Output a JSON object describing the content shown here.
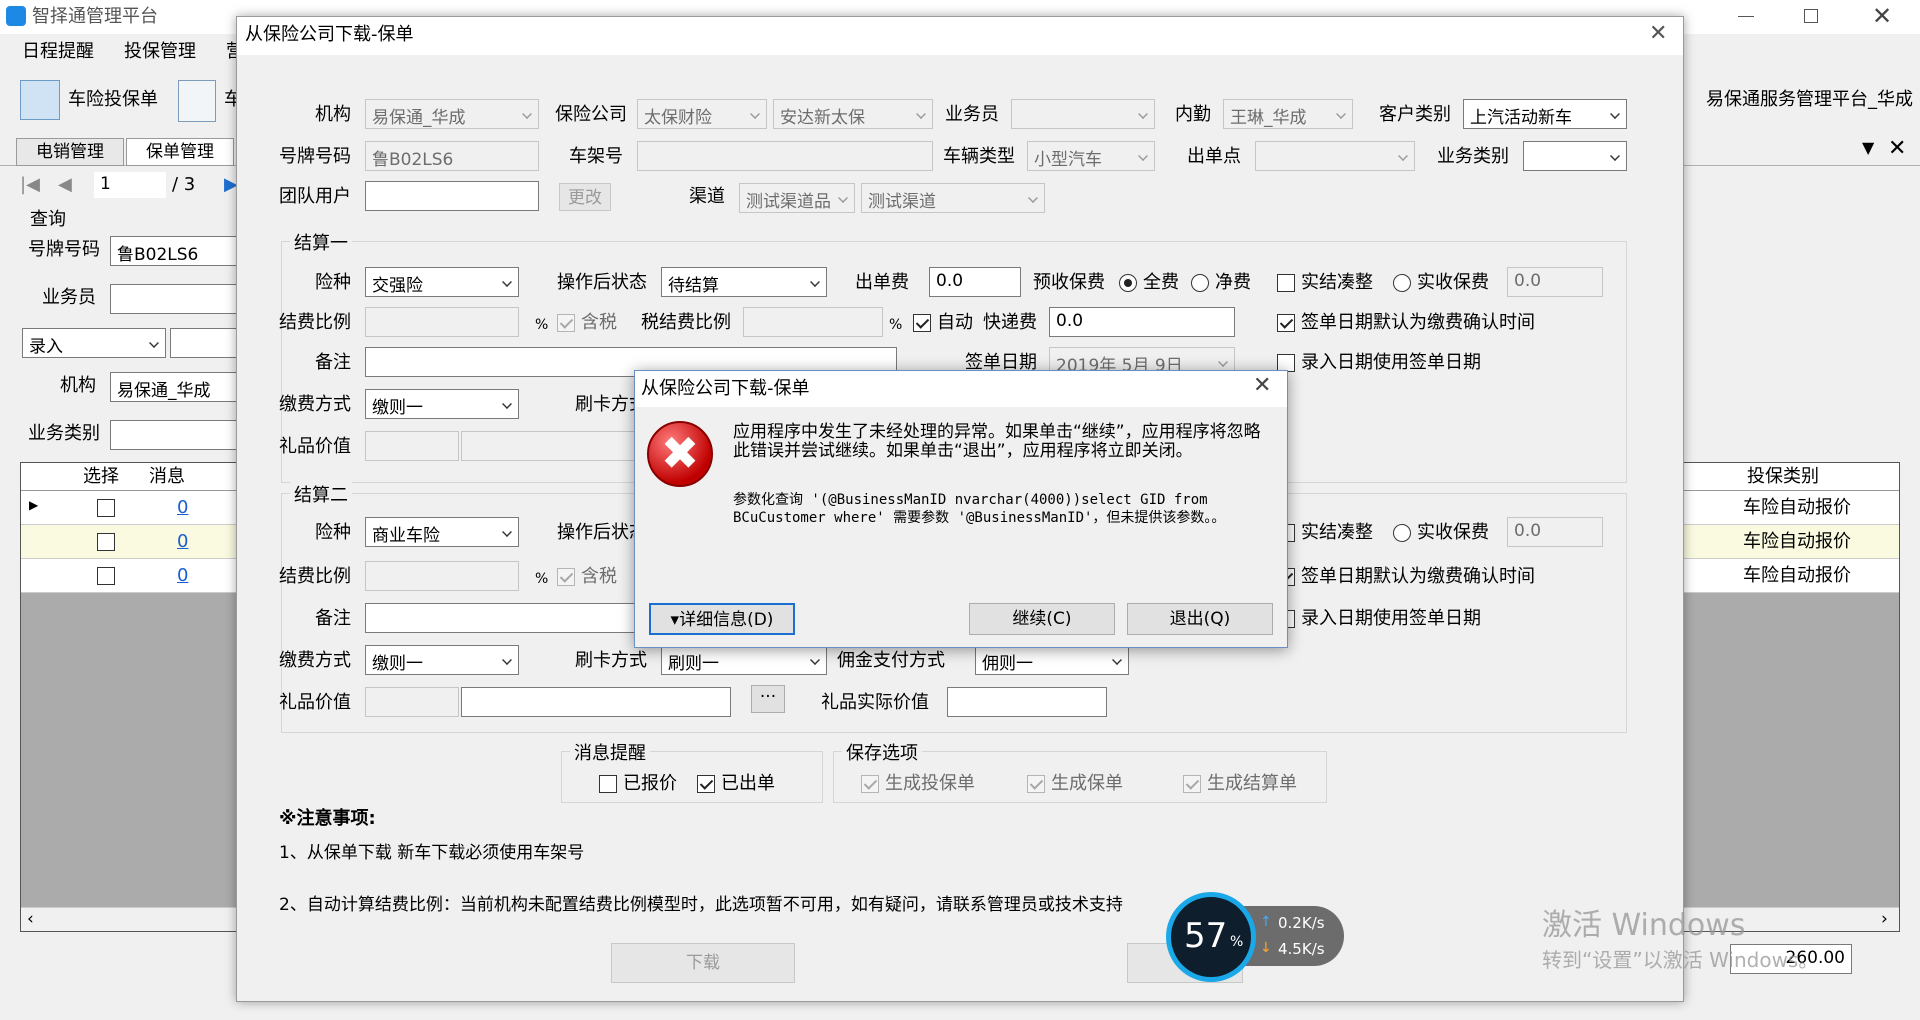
{
  "app": {
    "title": "智择通管理平台",
    "brand": "易保通服务管理平台_华成"
  },
  "menu": [
    "日程提醒",
    "投保管理",
    "营"
  ],
  "toolbar": {
    "car_ins": "车险投保单",
    "second": "车"
  },
  "tabs": [
    "电销管理",
    "保单管理"
  ],
  "pager": {
    "page": "1",
    "total": "/ 3"
  },
  "query": {
    "title": "查询",
    "plate_label": "号牌号码",
    "plate_value": "鲁B02LS6",
    "agent_label": "业务员",
    "entry_select": "录入",
    "org_label": "机构",
    "org_value": "易保通_华成",
    "biz_label": "业务类别"
  },
  "grid": {
    "col_select": "选择",
    "col_msg": "消息",
    "col_type": "投保类别",
    "rows": [
      {
        "msg": "0",
        "type": "车险自动报价"
      },
      {
        "msg": "0",
        "type": "车险自动报价"
      },
      {
        "msg": "0",
        "type": "车险自动报价"
      }
    ],
    "right_value": "260.00"
  },
  "form": {
    "title": "从保险公司下载-保单",
    "org_label": "机构",
    "org_value": "易保通_华成",
    "ins_label": "保险公司",
    "ins_value1": "太保财险",
    "ins_value2": "安达新太保",
    "agent_label": "业务员",
    "agent_value": "",
    "inner_label": "内勤",
    "inner_value": "王琳_华成",
    "cust_label": "客户类别",
    "cust_value": "上汽活动新车",
    "plate_label": "号牌号码",
    "plate_value": "鲁B02LS6",
    "vin_label": "车架号",
    "vin_value": "",
    "vtype_label": "车辆类型",
    "vtype_value": "小型汽车",
    "outlet_label": "出单点",
    "outlet_value": "",
    "biz_label": "业务类别",
    "biz_value": "",
    "team_label": "团队用户",
    "team_value": "",
    "change_btn": "更改",
    "channel_label": "渠道",
    "channel_value1": "测试渠道品",
    "channel_value2": "测试渠道",
    "s1": {
      "title": "结算一",
      "kind_label": "险种",
      "kind_value": "交强险",
      "status_label": "操作后状态",
      "status_value": "待结算",
      "fee_label": "出单费",
      "fee_value": "0.0",
      "pre_label": "预收保费",
      "full": "全费",
      "net": "净费",
      "real": "实结凑整",
      "realfee": "实收保费",
      "realfee_value": "0.0",
      "ratio_label": "结费比例",
      "pct": "%",
      "tax": "含税",
      "taxratio_label": "税结费比例",
      "auto": "自动",
      "express_label": "快递费",
      "express_value": "0.0",
      "signdef": "签单日期默认为缴费确认时间",
      "remark_label": "备注",
      "signdate_label": "签单日期",
      "signdate_value": "2019年 5月 9日",
      "entrydate": "录入日期使用签单日期",
      "pay_label": "缴费方式",
      "pay_value": "缴则一",
      "card_label": "刷卡方式",
      "gift_label": "礼品价值"
    },
    "s2": {
      "title": "结算二",
      "kind_label": "险种",
      "kind_value": "商业车险",
      "status_label": "操作后状态",
      "real": "实结凑整",
      "realfee": "实收保费",
      "realfee_value": "0.0",
      "ratio_label": "结费比例",
      "pct": "%",
      "tax": "含税",
      "signdef": "签单日期默认为缴费确认时间",
      "remark_label": "备注",
      "entrydate": "录入日期使用签单日期",
      "pay_label": "缴费方式",
      "pay_value": "缴则一",
      "card_label": "刷卡方式",
      "card_value": "刷则一",
      "comm_label": "佣金支付方式",
      "comm_value": "佣则一",
      "gift_label": "礼品价值",
      "gift_btn": "···",
      "giftreal_label": "礼品实际价值"
    },
    "msg": {
      "title": "消息提醒",
      "quoted": "已报价",
      "issued": "已出单"
    },
    "save": {
      "title": "保存选项",
      "opt1": "生成投保单",
      "opt2": "生成保单",
      "opt3": "生成结算单"
    },
    "notes": {
      "title": "※注意事项:",
      "n1": "1、从保单下载 新车下载必须使用车架号",
      "n2": "2、自动计算结费比例：当前机构未配置结费比例模型时，此选项暂不可用，如有疑问，请联系管理员或技术支持"
    },
    "download_btn": "下载"
  },
  "dialog": {
    "title": "从保险公司下载-保单",
    "msg1": "应用程序中发生了未经处理的异常。如果单击“继续”，应用程序将忽略此错误并尝试继续。如果单击“退出”，应用程序将立即关闭。",
    "msg2": "参数化查询 '(@BusinessManID nvarchar(4000))select GID from BCuCustomer where' 需要参数 '@BusinessManID'，但未提供该参数。。",
    "details": "▾详细信息(D)",
    "continue": "继续(C)",
    "quit": "退出(Q)"
  },
  "net": {
    "percent": "57",
    "unit": "%",
    "up": "0.2K/s",
    "down": "4.5K/s"
  },
  "watermark": {
    "line1": "激活 Windows",
    "line2": "转到“设置”以激活 Windows。"
  }
}
